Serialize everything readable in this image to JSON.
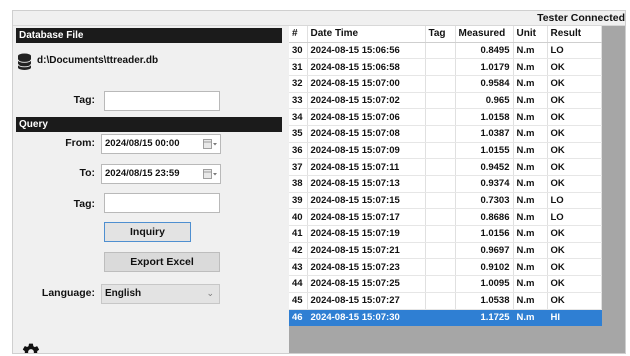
{
  "status": {
    "text": "Tester Connected"
  },
  "left": {
    "database_header": "Database File",
    "db_icon": "database-icon",
    "db_path": "d:\\Documents\\ttreader.db",
    "tag_label": "Tag:",
    "tag_value": "",
    "query_header": "Query",
    "from_label": "From:",
    "from_value": "2024/08/15 00:00",
    "to_label": "To:",
    "to_value": "2024/08/15 23:59",
    "query_tag_label": "Tag:",
    "query_tag_value": "",
    "inquiry_label": "Inquiry",
    "export_label": "Export Excel",
    "language_label": "Language:",
    "language_value": "English",
    "settings_icon": "gear-icon"
  },
  "table": {
    "columns": [
      "#",
      "Date Time",
      "Tag",
      "Measured",
      "Unit",
      "Result"
    ],
    "rows": [
      [
        "30",
        "2024-08-15 15:06:56",
        "",
        "0.8495",
        "N.m",
        "LO"
      ],
      [
        "31",
        "2024-08-15 15:06:58",
        "",
        "1.0179",
        "N.m",
        "OK"
      ],
      [
        "32",
        "2024-08-15 15:07:00",
        "",
        "0.9584",
        "N.m",
        "OK"
      ],
      [
        "33",
        "2024-08-15 15:07:02",
        "",
        "0.965",
        "N.m",
        "OK"
      ],
      [
        "34",
        "2024-08-15 15:07:06",
        "",
        "1.0158",
        "N.m",
        "OK"
      ],
      [
        "35",
        "2024-08-15 15:07:08",
        "",
        "1.0387",
        "N.m",
        "OK"
      ],
      [
        "36",
        "2024-08-15 15:07:09",
        "",
        "1.0155",
        "N.m",
        "OK"
      ],
      [
        "37",
        "2024-08-15 15:07:11",
        "",
        "0.9452",
        "N.m",
        "OK"
      ],
      [
        "38",
        "2024-08-15 15:07:13",
        "",
        "0.9374",
        "N.m",
        "OK"
      ],
      [
        "39",
        "2024-08-15 15:07:15",
        "",
        "0.7303",
        "N.m",
        "LO"
      ],
      [
        "40",
        "2024-08-15 15:07:17",
        "",
        "0.8686",
        "N.m",
        "LO"
      ],
      [
        "41",
        "2024-08-15 15:07:19",
        "",
        "1.0156",
        "N.m",
        "OK"
      ],
      [
        "42",
        "2024-08-15 15:07:21",
        "",
        "0.9697",
        "N.m",
        "OK"
      ],
      [
        "43",
        "2024-08-15 15:07:23",
        "",
        "0.9102",
        "N.m",
        "OK"
      ],
      [
        "44",
        "2024-08-15 15:07:25",
        "",
        "1.0095",
        "N.m",
        "OK"
      ],
      [
        "45",
        "2024-08-15 15:07:27",
        "",
        "1.0538",
        "N.m",
        "OK"
      ],
      [
        "46",
        "2024-08-15 15:07:30",
        "",
        "1.1725",
        "N.m",
        "HI"
      ]
    ],
    "selected_index": 16
  },
  "colors": {
    "header_bg": "#1b1b1b",
    "selected_row": "#2f7fd3",
    "empty_area": "#a6a6a6"
  }
}
